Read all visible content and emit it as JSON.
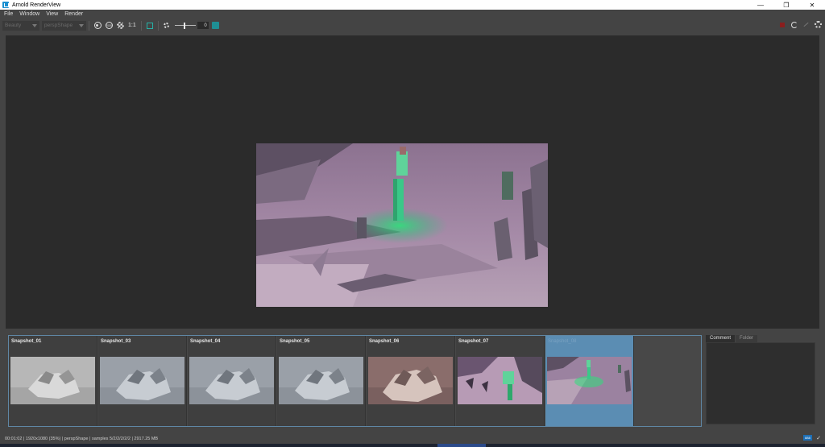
{
  "window": {
    "title": "Arnold RenderView"
  },
  "menu": [
    "File",
    "Window",
    "View",
    "Render"
  ],
  "toolbar": {
    "aov": "Beauty",
    "camera": "perspShape",
    "zoom_label": "1:1",
    "exposure_value": "0"
  },
  "snapshots": [
    {
      "label": "Snapshot_01",
      "style": "grey",
      "selected": false
    },
    {
      "label": "Snapshot_03",
      "style": "bluegrey",
      "selected": false
    },
    {
      "label": "Snapshot_04",
      "style": "bluegrey",
      "selected": false
    },
    {
      "label": "Snapshot_05",
      "style": "bluegrey",
      "selected": false
    },
    {
      "label": "Snapshot_06",
      "style": "warm",
      "selected": false
    },
    {
      "label": "Snapshot_07",
      "style": "magenta",
      "selected": false
    },
    {
      "label": "Snapshot_08",
      "style": "scene",
      "selected": true
    }
  ],
  "side_panel": {
    "tabs": [
      "Comment",
      "Folder"
    ],
    "active_tab": "Comment"
  },
  "status": {
    "text": "00:01:02 | 1920x1080 (35%) | perspShape  | samples 5/2/2/2/2/2 | 2917.25 MB"
  },
  "colors": {
    "accent": "#5b8db3",
    "stop": "#8a1e1e",
    "teal": "#1f8f94"
  }
}
